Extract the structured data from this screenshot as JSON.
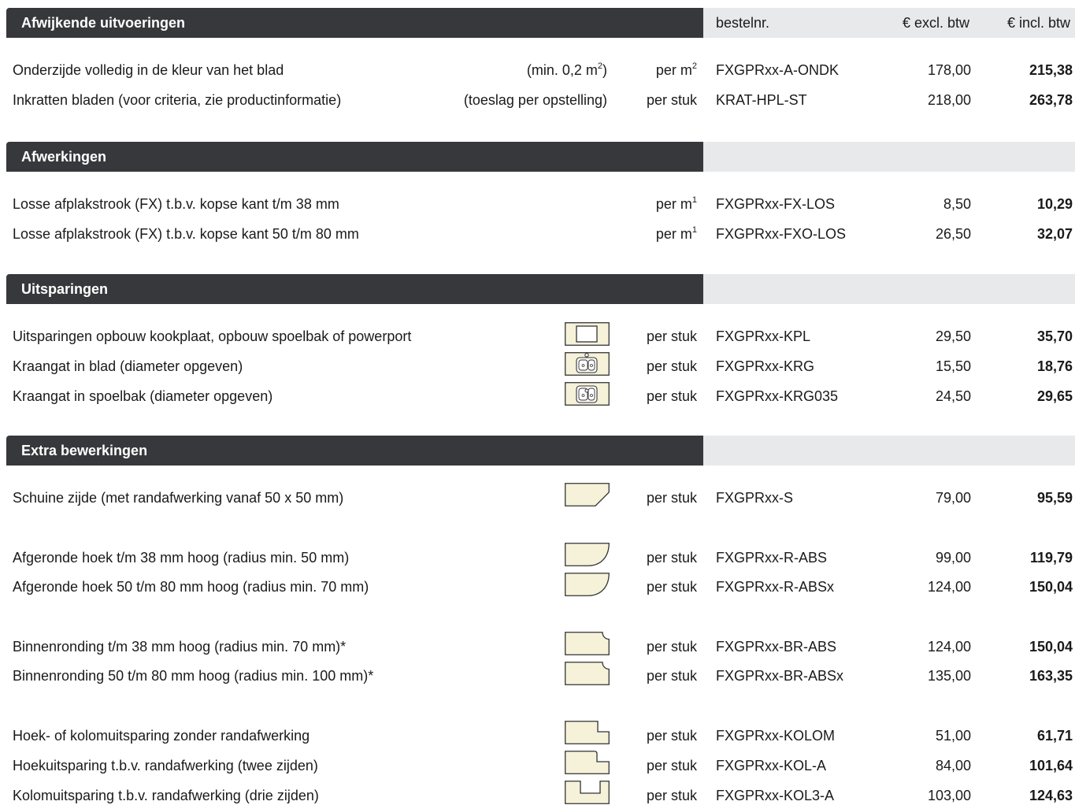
{
  "columns": {
    "bestelnr": "bestelnr.",
    "excl": "€ excl. btw",
    "incl": "€ incl. btw"
  },
  "sections": [
    {
      "title": "Afwijkende uitvoeringen",
      "rows": [
        {
          "desc": "Onderzijde volledig in de kleur van het blad",
          "note": "(min. 0,2 m",
          "note_sup": "2",
          "note_end": ")",
          "unit": "per m",
          "unit_sup": "2",
          "code": "FXGPRxx-A-ONDK",
          "excl": "178,00",
          "incl": "215,38"
        },
        {
          "desc": "Inkratten bladen (voor criteria, zie productinformatie)",
          "note": "(toeslag per opstelling)",
          "unit": "per stuk",
          "code": "KRAT-HPL-ST",
          "excl": "218,00",
          "incl": "263,78"
        }
      ]
    },
    {
      "title": "Afwerkingen",
      "rows": [
        {
          "desc": "Losse afplakstrook (FX) t.b.v. kopse kant t/m 38 mm",
          "unit": "per m",
          "unit_sup": "1",
          "code": "FXGPRxx-FX-LOS",
          "excl": "8,50",
          "incl": "10,29"
        },
        {
          "desc": "Losse afplakstrook (FX) t.b.v. kopse kant 50 t/m 80 mm",
          "unit": "per m",
          "unit_sup": "1",
          "code": "FXGPRxx-FXO-LOS",
          "excl": "26,50",
          "incl": "32,07"
        }
      ]
    },
    {
      "title": "Uitsparingen",
      "rows": [
        {
          "desc": "Uitsparingen opbouw kookplaat, opbouw spoelbak of powerport",
          "icon": "cutout-square-icon",
          "unit": "per stuk",
          "code": "FXGPRxx-KPL",
          "excl": "29,50",
          "incl": "35,70"
        },
        {
          "desc": "Kraangat in blad (diameter opgeven)",
          "icon": "tap-hole-blade-icon",
          "unit": "per stuk",
          "code": "FXGPRxx-KRG",
          "excl": "15,50",
          "incl": "18,76"
        },
        {
          "desc": "Kraangat in spoelbak (diameter opgeven)",
          "icon": "tap-hole-sink-icon",
          "unit": "per stuk",
          "code": "FXGPRxx-KRG035",
          "excl": "24,50",
          "incl": "29,65"
        }
      ]
    },
    {
      "title": "Extra bewerkingen",
      "rows": [
        {
          "desc": "Schuine zijde (met randafwerking vanaf 50 x 50 mm)",
          "icon": "bevel-corner-icon",
          "unit": "per stuk",
          "code": "FXGPRxx-S",
          "excl": "79,00",
          "incl": "95,59"
        },
        {
          "desc": "Afgeronde hoek t/m 38 mm hoog (radius min. 50 mm)",
          "icon": "rounded-corner-icon",
          "unit": "per stuk",
          "code": "FXGPRxx-R-ABS",
          "excl": "99,00",
          "incl": "119,79"
        },
        {
          "desc": "Afgeronde hoek 50 t/m 80 mm hoog (radius min. 70 mm)",
          "icon": "rounded-corner-icon",
          "unit": "per stuk",
          "code": "FXGPRxx-R-ABSx",
          "excl": "124,00",
          "incl": "150,04"
        },
        {
          "desc": "Binnenronding t/m 38 mm hoog (radius min. 70 mm)*",
          "icon": "inner-round-icon",
          "unit": "per stuk",
          "code": "FXGPRxx-BR-ABS",
          "excl": "124,00",
          "incl": "150,04"
        },
        {
          "desc": "Binnenronding 50 t/m 80 mm hoog (radius min. 100 mm)*",
          "icon": "inner-round-icon",
          "unit": "per stuk",
          "code": "FXGPRxx-BR-ABSx",
          "excl": "135,00",
          "incl": "163,35"
        },
        {
          "desc": "Hoek- of kolomuitsparing zonder randafwerking",
          "icon": "corner-notch-icon",
          "unit": "per stuk",
          "code": "FXGPRxx-KOLOM",
          "excl": "51,00",
          "incl": "61,71"
        },
        {
          "desc": "Hoekuitsparing t.b.v. randafwerking (twee zijden)",
          "icon": "corner-notch-edge-icon",
          "unit": "per stuk",
          "code": "FXGPRxx-KOL-A",
          "excl": "84,00",
          "incl": "101,64"
        },
        {
          "desc": "Kolomuitsparing t.b.v. randafwerking (drie zijden)",
          "icon": "column-notch-icon",
          "unit": "per stuk",
          "code": "FXGPRxx-KOL3-A",
          "excl": "103,00",
          "incl": "124,63"
        }
      ]
    }
  ],
  "colors": {
    "header_dark": "#36383c",
    "header_light": "#e8e9ea",
    "icon_fill": "#f6f2da",
    "icon_stroke": "#333333"
  }
}
